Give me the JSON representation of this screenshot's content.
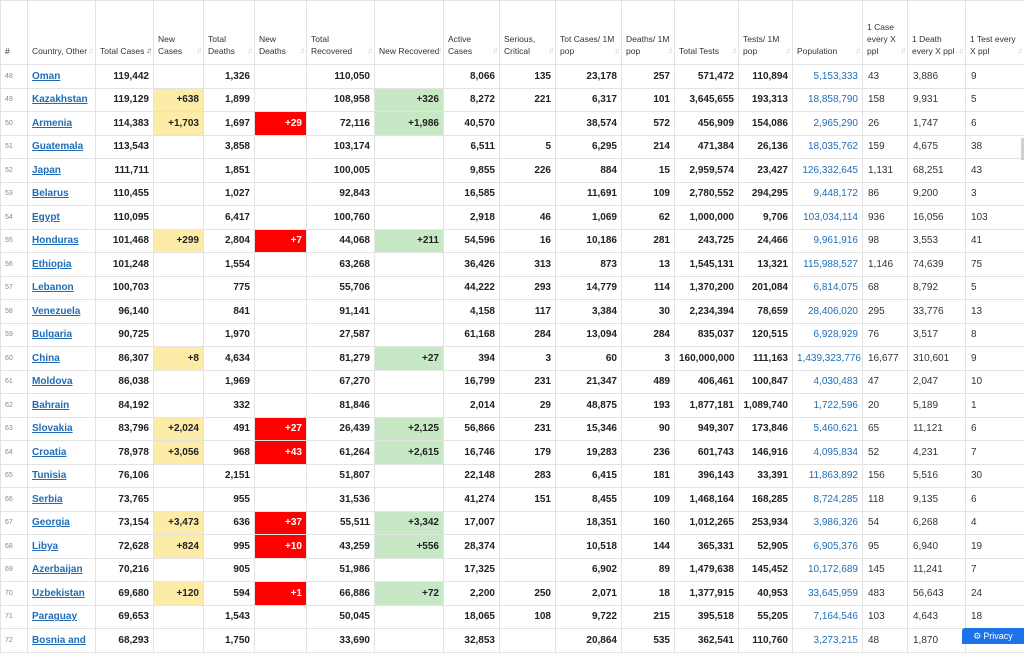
{
  "columns": [
    {
      "key": "idx",
      "label": "#"
    },
    {
      "key": "country",
      "label": "Country, Other"
    },
    {
      "key": "total_cases",
      "label": "Total Cases"
    },
    {
      "key": "new_cases",
      "label": "New Cases"
    },
    {
      "key": "total_deaths",
      "label": "Total Deaths"
    },
    {
      "key": "new_deaths",
      "label": "New Deaths"
    },
    {
      "key": "total_recovered",
      "label": "Total Recovered"
    },
    {
      "key": "new_recovered",
      "label": "New Recovered"
    },
    {
      "key": "active_cases",
      "label": "Active Cases"
    },
    {
      "key": "serious",
      "label": "Serious, Critical"
    },
    {
      "key": "cases_1m",
      "label": "Tot Cases/ 1M pop"
    },
    {
      "key": "deaths_1m",
      "label": "Deaths/ 1M pop"
    },
    {
      "key": "total_tests",
      "label": "Total Tests"
    },
    {
      "key": "tests_1m",
      "label": "Tests/ 1M pop"
    },
    {
      "key": "population",
      "label": "Population"
    },
    {
      "key": "case_every",
      "label": "1 Case every X ppl"
    },
    {
      "key": "death_every",
      "label": "1 Death every X ppl"
    },
    {
      "key": "test_every",
      "label": "1 Test every X ppl"
    }
  ],
  "sorted_column": "total_cases",
  "rows": [
    [
      "48",
      "Oman",
      "119,442",
      "",
      "1,326",
      "",
      "110,050",
      "",
      "8,066",
      "135",
      "23,178",
      "257",
      "571,472",
      "110,894",
      "5,153,333",
      "43",
      "3,886",
      "9"
    ],
    [
      "49",
      "Kazakhstan",
      "119,129",
      "+638",
      "1,899",
      "",
      "108,958",
      "+326",
      "8,272",
      "221",
      "6,317",
      "101",
      "3,645,655",
      "193,313",
      "18,858,790",
      "158",
      "9,931",
      "5"
    ],
    [
      "50",
      "Armenia",
      "114,383",
      "+1,703",
      "1,697",
      "+29",
      "72,116",
      "+1,986",
      "40,570",
      "",
      "38,574",
      "572",
      "456,909",
      "154,086",
      "2,965,290",
      "26",
      "1,747",
      "6"
    ],
    [
      "51",
      "Guatemala",
      "113,543",
      "",
      "3,858",
      "",
      "103,174",
      "",
      "6,511",
      "5",
      "6,295",
      "214",
      "471,384",
      "26,136",
      "18,035,762",
      "159",
      "4,675",
      "38"
    ],
    [
      "52",
      "Japan",
      "111,711",
      "",
      "1,851",
      "",
      "100,005",
      "",
      "9,855",
      "226",
      "884",
      "15",
      "2,959,574",
      "23,427",
      "126,332,645",
      "1,131",
      "68,251",
      "43"
    ],
    [
      "53",
      "Belarus",
      "110,455",
      "",
      "1,027",
      "",
      "92,843",
      "",
      "16,585",
      "",
      "11,691",
      "109",
      "2,780,552",
      "294,295",
      "9,448,172",
      "86",
      "9,200",
      "3"
    ],
    [
      "54",
      "Egypt",
      "110,095",
      "",
      "6,417",
      "",
      "100,760",
      "",
      "2,918",
      "46",
      "1,069",
      "62",
      "1,000,000",
      "9,706",
      "103,034,114",
      "936",
      "16,056",
      "103"
    ],
    [
      "55",
      "Honduras",
      "101,468",
      "+299",
      "2,804",
      "+7",
      "44,068",
      "+211",
      "54,596",
      "16",
      "10,186",
      "281",
      "243,725",
      "24,466",
      "9,961,916",
      "98",
      "3,553",
      "41"
    ],
    [
      "56",
      "Ethiopia",
      "101,248",
      "",
      "1,554",
      "",
      "63,268",
      "",
      "36,426",
      "313",
      "873",
      "13",
      "1,545,131",
      "13,321",
      "115,988,527",
      "1,146",
      "74,639",
      "75"
    ],
    [
      "57",
      "Lebanon",
      "100,703",
      "",
      "775",
      "",
      "55,706",
      "",
      "44,222",
      "293",
      "14,779",
      "114",
      "1,370,200",
      "201,084",
      "6,814,075",
      "68",
      "8,792",
      "5"
    ],
    [
      "58",
      "Venezuela",
      "96,140",
      "",
      "841",
      "",
      "91,141",
      "",
      "4,158",
      "117",
      "3,384",
      "30",
      "2,234,394",
      "78,659",
      "28,406,020",
      "295",
      "33,776",
      "13"
    ],
    [
      "59",
      "Bulgaria",
      "90,725",
      "",
      "1,970",
      "",
      "27,587",
      "",
      "61,168",
      "284",
      "13,094",
      "284",
      "835,037",
      "120,515",
      "6,928,929",
      "76",
      "3,517",
      "8"
    ],
    [
      "60",
      "China",
      "86,307",
      "+8",
      "4,634",
      "",
      "81,279",
      "+27",
      "394",
      "3",
      "60",
      "3",
      "160,000,000",
      "111,163",
      "1,439,323,776",
      "16,677",
      "310,601",
      "9"
    ],
    [
      "61",
      "Moldova",
      "86,038",
      "",
      "1,969",
      "",
      "67,270",
      "",
      "16,799",
      "231",
      "21,347",
      "489",
      "406,461",
      "100,847",
      "4,030,483",
      "47",
      "2,047",
      "10"
    ],
    [
      "62",
      "Bahrain",
      "84,192",
      "",
      "332",
      "",
      "81,846",
      "",
      "2,014",
      "29",
      "48,875",
      "193",
      "1,877,181",
      "1,089,740",
      "1,722,596",
      "20",
      "5,189",
      "1"
    ],
    [
      "63",
      "Slovakia",
      "83,796",
      "+2,024",
      "491",
      "+27",
      "26,439",
      "+2,125",
      "56,866",
      "231",
      "15,346",
      "90",
      "949,307",
      "173,846",
      "5,460,621",
      "65",
      "11,121",
      "6"
    ],
    [
      "64",
      "Croatia",
      "78,978",
      "+3,056",
      "968",
      "+43",
      "61,264",
      "+2,615",
      "16,746",
      "179",
      "19,283",
      "236",
      "601,743",
      "146,916",
      "4,095,834",
      "52",
      "4,231",
      "7"
    ],
    [
      "65",
      "Tunisia",
      "76,106",
      "",
      "2,151",
      "",
      "51,807",
      "",
      "22,148",
      "283",
      "6,415",
      "181",
      "396,143",
      "33,391",
      "11,863,892",
      "156",
      "5,516",
      "30"
    ],
    [
      "66",
      "Serbia",
      "73,765",
      "",
      "955",
      "",
      "31,536",
      "",
      "41,274",
      "151",
      "8,455",
      "109",
      "1,468,164",
      "168,285",
      "8,724,285",
      "118",
      "9,135",
      "6"
    ],
    [
      "67",
      "Georgia",
      "73,154",
      "+3,473",
      "636",
      "+37",
      "55,511",
      "+3,342",
      "17,007",
      "",
      "18,351",
      "160",
      "1,012,265",
      "253,934",
      "3,986,326",
      "54",
      "6,268",
      "4"
    ],
    [
      "68",
      "Libya",
      "72,628",
      "+824",
      "995",
      "+10",
      "43,259",
      "+556",
      "28,374",
      "",
      "10,518",
      "144",
      "365,331",
      "52,905",
      "6,905,376",
      "95",
      "6,940",
      "19"
    ],
    [
      "69",
      "Azerbaijan",
      "70,216",
      "",
      "905",
      "",
      "51,986",
      "",
      "17,325",
      "",
      "6,902",
      "89",
      "1,479,638",
      "145,452",
      "10,172,689",
      "145",
      "11,241",
      "7"
    ],
    [
      "70",
      "Uzbekistan",
      "69,680",
      "+120",
      "594",
      "+1",
      "66,886",
      "+72",
      "2,200",
      "250",
      "2,071",
      "18",
      "1,377,915",
      "40,953",
      "33,645,959",
      "483",
      "56,643",
      "24"
    ],
    [
      "71",
      "Paraguay",
      "69,653",
      "",
      "1,543",
      "",
      "50,045",
      "",
      "18,065",
      "108",
      "9,722",
      "215",
      "395,518",
      "55,205",
      "7,164,546",
      "103",
      "4,643",
      "18"
    ],
    [
      "72",
      "Bosnia and",
      "68,293",
      "",
      "1,750",
      "",
      "33,690",
      "",
      "32,853",
      "",
      "20,864",
      "535",
      "362,541",
      "110,760",
      "3,273,215",
      "48",
      "1,870",
      ""
    ]
  ],
  "privacy_button": {
    "label": "Privacy",
    "icon": "gear-icon"
  },
  "colors": {
    "new_cases": "#fdeba8",
    "new_deaths": "#ff0000",
    "new_recovered": "#c7e8c5",
    "link": "#1f6db7"
  }
}
